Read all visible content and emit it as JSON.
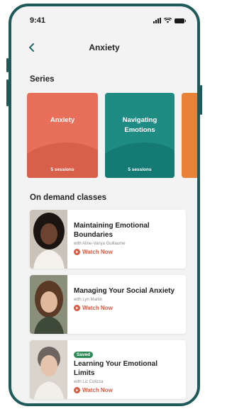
{
  "status_bar": {
    "time": "9:41"
  },
  "nav": {
    "title": "Anxiety"
  },
  "series": {
    "heading": "Series",
    "cards": [
      {
        "title": "Anxiety",
        "sessions": "5 sessions",
        "color": "#e8705a",
        "blob_color": "#d85f4a"
      },
      {
        "title": "Navigating Emotions",
        "sessions": "5 sessions",
        "color": "#1f8c84",
        "blob_color": "#157a73"
      }
    ],
    "peek_color": "#e88236"
  },
  "on_demand": {
    "heading": "On demand classes",
    "classes": [
      {
        "title": "Maintaining Emotional Boundaries",
        "instructor": "with Aline-Vanya Guillaume",
        "action": "Watch Now",
        "saved": false
      },
      {
        "title": "Managing Your Social Anxiety",
        "instructor": "with Lyn Martin",
        "action": "Watch Now",
        "saved": false
      },
      {
        "title": "Learning Your Emotional Limits",
        "instructor": "with Liz Colizza",
        "action": "Watch Now",
        "saved": true,
        "badge": "Saved"
      }
    ]
  },
  "colors": {
    "frame": "#1f5a5a",
    "accent": "#d95b43",
    "saved": "#2e8b57"
  },
  "icons": {
    "back": "back-chevron-icon",
    "play": "play-circle-icon",
    "signal": "signal-icon",
    "wifi": "wifi-icon",
    "battery": "battery-icon"
  }
}
